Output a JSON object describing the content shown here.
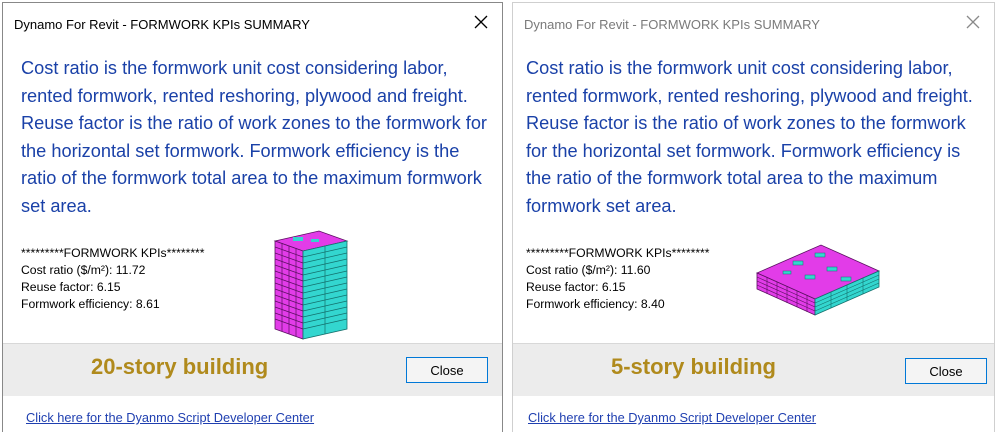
{
  "dialogs": [
    {
      "title": "Dynamo For Revit - FORMWORK KPIs SUMMARY",
      "description": "Cost ratio is the formwork unit cost considering labor, rented formwork, rented reshoring, plywood and freight. Reuse factor is the ratio of work zones to the formwork for the horizontal set formwork. Formwork efficiency is the ratio of the formwork total area to the maximum formwork set area.",
      "kpi_header": "*********FORMWORK KPIs********",
      "cost_ratio": "Cost ratio ($/m²): 11.72",
      "reuse_factor": "Reuse factor: 6.15",
      "formwork_efficiency": "Formwork efficiency: 8.61",
      "caption": "20-story building",
      "close_label": "Close",
      "link": "Click here for the Dyanmo Script Developer Center",
      "close_icon": "close-x-icon",
      "building_image": "20-story-building-model"
    },
    {
      "title": "Dynamo For Revit - FORMWORK KPIs SUMMARY",
      "description": "Cost ratio is the formwork unit cost considering labor, rented formwork, rented reshoring, plywood and freight. Reuse factor is the ratio of work zones to the formwork for the horizontal set formwork. Formwork efficiency is the ratio of the formwork total area to the maximum formwork set area.",
      "kpi_header": "*********FORMWORK KPIs********",
      "cost_ratio": "Cost ratio ($/m²): 11.60",
      "reuse_factor": "Reuse factor: 6.15",
      "formwork_efficiency": "Formwork efficiency: 8.40",
      "caption": "5-story building",
      "close_label": "Close",
      "link": "Click here for the Dyanmo Script Developer Center",
      "close_icon": "close-x-icon",
      "building_image": "5-story-building-model"
    }
  ],
  "colors": {
    "description_text": "#1a41a8",
    "caption_text": "#b08a1c",
    "button_border": "#0078d7",
    "link": "#1f3fb0",
    "building_slab": "#e23ce8",
    "building_face": "#33d6cf"
  }
}
